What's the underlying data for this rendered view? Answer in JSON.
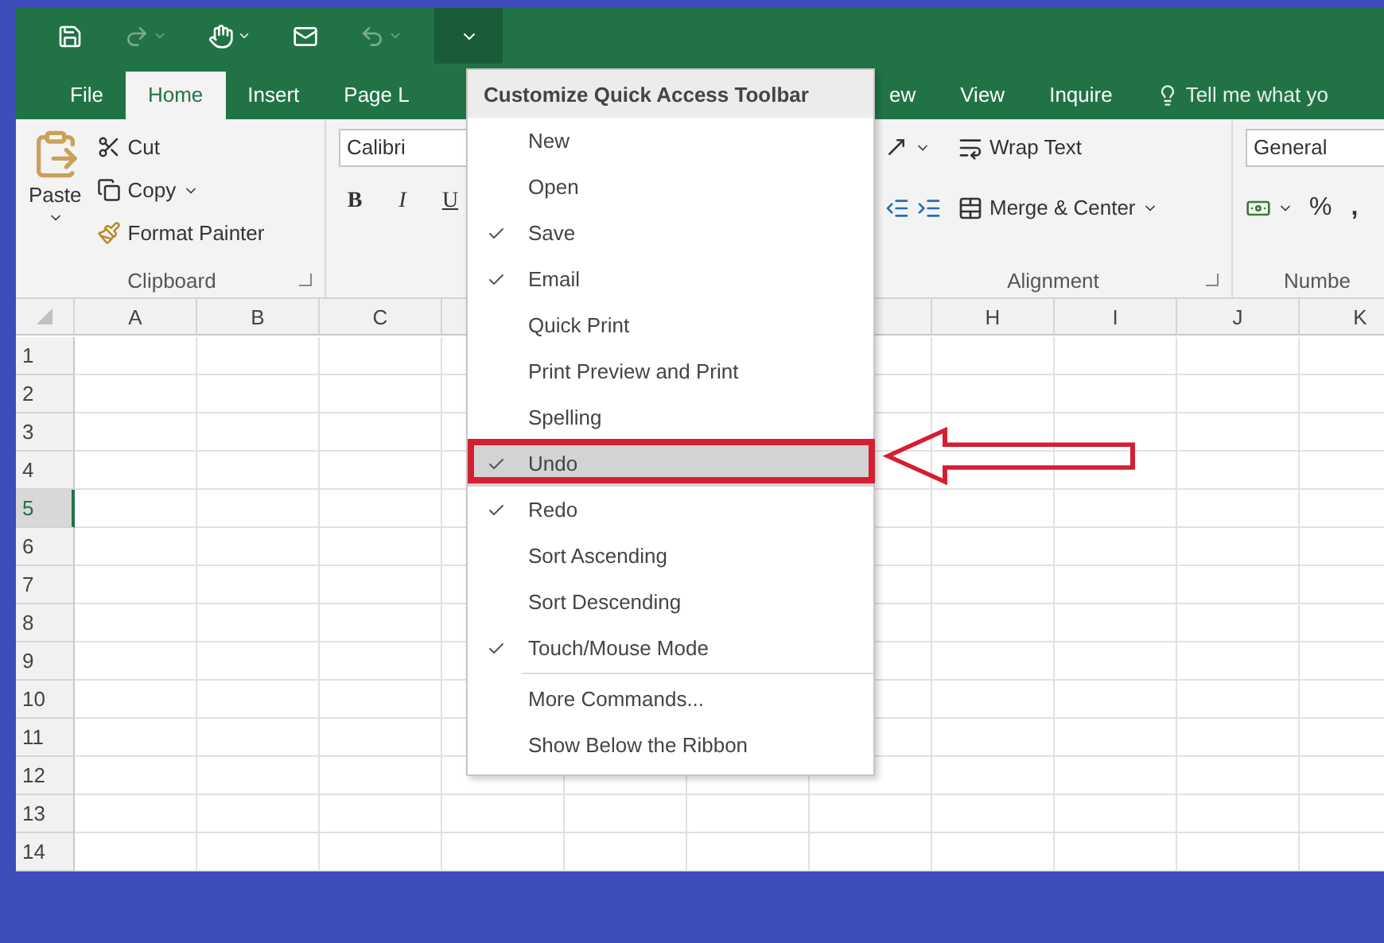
{
  "quick_access": [
    {
      "kind": "save",
      "disabled": false,
      "has_menu": false,
      "selected": false
    },
    {
      "kind": "redo",
      "disabled": true,
      "has_menu": true,
      "selected": false
    },
    {
      "kind": "touch",
      "disabled": false,
      "has_menu": true,
      "selected": false
    },
    {
      "kind": "mail",
      "disabled": false,
      "has_menu": false,
      "selected": false
    },
    {
      "kind": "undo",
      "disabled": true,
      "has_menu": true,
      "selected": false
    },
    {
      "kind": "customize",
      "disabled": false,
      "has_menu": false,
      "selected": true
    }
  ],
  "ribbon_tabs": {
    "left": [
      {
        "label": "File",
        "selected": false
      },
      {
        "label": "Home",
        "selected": true
      },
      {
        "label": "Insert",
        "selected": false
      },
      {
        "label": "Page L",
        "selected": false
      }
    ],
    "right": [
      {
        "label": "ew",
        "selected": false
      },
      {
        "label": "View",
        "selected": false
      },
      {
        "label": "Inquire",
        "selected": false
      }
    ],
    "tell_me": "Tell me what yo"
  },
  "ribbon": {
    "clipboard": {
      "paste": "Paste",
      "cut": "Cut",
      "copy": "Copy",
      "format_painter": "Format Painter",
      "label": "Clipboard"
    },
    "font": {
      "font_name": "Calibri",
      "bold": "B",
      "italic": "I",
      "underline": "U"
    },
    "alignment": {
      "wrap_text": "Wrap Text",
      "merge_center": "Merge & Center",
      "label": "Alignment"
    },
    "number": {
      "format": "General",
      "percent": "%",
      "comma": ",",
      "label": "Numbe"
    }
  },
  "sheet": {
    "columns_left": [
      "A",
      "B",
      "C"
    ],
    "columns_right": [
      "H",
      "I",
      "J",
      "K"
    ],
    "rows": [
      {
        "label": "1",
        "selected": false
      },
      {
        "label": "2",
        "selected": false
      },
      {
        "label": "3",
        "selected": false
      },
      {
        "label": "4",
        "selected": false
      },
      {
        "label": "5",
        "selected": true
      },
      {
        "label": "6",
        "selected": false
      },
      {
        "label": "7",
        "selected": false
      },
      {
        "label": "8",
        "selected": false
      },
      {
        "label": "9",
        "selected": false
      },
      {
        "label": "10",
        "selected": false
      },
      {
        "label": "11",
        "selected": false
      },
      {
        "label": "12",
        "selected": false
      },
      {
        "label": "13",
        "selected": false
      },
      {
        "label": "14",
        "selected": false
      }
    ]
  },
  "menu": {
    "title": "Customize Quick Access Toolbar",
    "items": [
      {
        "kind": "toggle",
        "label": "New",
        "checked": false,
        "selected": false
      },
      {
        "kind": "toggle",
        "label": "Open",
        "checked": false,
        "selected": false
      },
      {
        "kind": "toggle",
        "label": "Save",
        "checked": true,
        "selected": false
      },
      {
        "kind": "toggle",
        "label": "Email",
        "checked": true,
        "selected": false
      },
      {
        "kind": "toggle",
        "label": "Quick Print",
        "checked": false,
        "selected": false
      },
      {
        "kind": "toggle",
        "label": "Print Preview and Print",
        "checked": false,
        "selected": false
      },
      {
        "kind": "toggle",
        "label": "Spelling",
        "checked": false,
        "selected": false
      },
      {
        "kind": "toggle",
        "label": "Undo",
        "checked": true,
        "selected": true
      },
      {
        "kind": "toggle",
        "label": "Redo",
        "checked": true,
        "selected": false
      },
      {
        "kind": "toggle",
        "label": "Sort Ascending",
        "checked": false,
        "selected": false
      },
      {
        "kind": "toggle",
        "label": "Sort Descending",
        "checked": false,
        "selected": false
      },
      {
        "kind": "toggle",
        "label": "Touch/Mouse Mode",
        "checked": true,
        "selected": false
      },
      {
        "kind": "command",
        "label": "More Commands...",
        "selected": false
      },
      {
        "kind": "command",
        "label": "Show Below the Ribbon",
        "selected": false
      }
    ]
  }
}
